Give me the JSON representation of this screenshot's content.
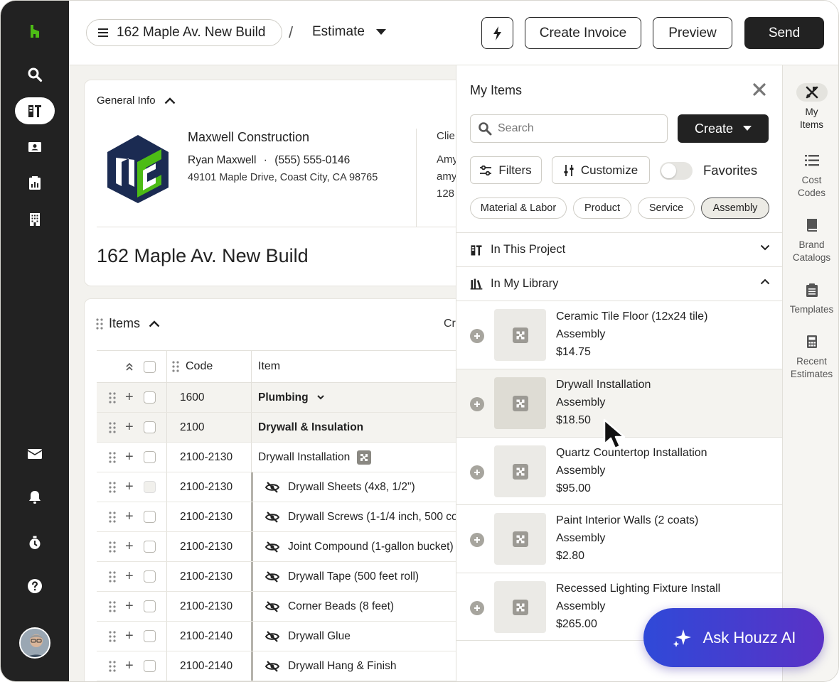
{
  "header": {
    "project_name": "162 Maple Av. New Build",
    "breadcrumb_sep": "/",
    "document_type": "Estimate",
    "create_invoice": "Create Invoice",
    "preview": "Preview",
    "send": "Send"
  },
  "general_info": {
    "title": "General Info",
    "company": "Maxwell Construction",
    "contact_name": "Ryan Maxwell",
    "contact_sep": "·",
    "phone": "(555) 555-0146",
    "address": "49101 Maple Drive, Coast City, CA 98765",
    "client_label_cut": "Clie",
    "client_line1_cut": "Amy",
    "client_line2_cut": "amy",
    "client_line3_cut": "128",
    "project_title": "162 Maple Av. New Build"
  },
  "items_section": {
    "title": "Items",
    "create_cut": "Cr",
    "columns": {
      "code": "Code",
      "item": "Item"
    },
    "rows": [
      {
        "code": "1600",
        "item": "Plumbing",
        "kind": "group-dropdown"
      },
      {
        "code": "2100",
        "item": "Drywall & Insulation",
        "kind": "group"
      },
      {
        "code": "2100-2130",
        "item": "Drywall Installation",
        "kind": "assembly"
      },
      {
        "code": "2100-2130",
        "item": "Drywall Sheets (4x8, 1/2\")",
        "kind": "hidden"
      },
      {
        "code": "2100-2130",
        "item": "Drywall Screws (1-1/4 inch, 500 co",
        "kind": "hidden"
      },
      {
        "code": "2100-2130",
        "item": "Joint Compound (1-gallon bucket)",
        "kind": "hidden"
      },
      {
        "code": "2100-2130",
        "item": "Drywall Tape (500 feet roll)",
        "kind": "hidden"
      },
      {
        "code": "2100-2130",
        "item": "Corner Beads (8 feet)",
        "kind": "hidden"
      },
      {
        "code": "2100-2140",
        "item": "Drywall Glue",
        "kind": "hidden"
      },
      {
        "code": "2100-2140",
        "item": "Drywall Hang & Finish",
        "kind": "hidden"
      }
    ]
  },
  "my_items": {
    "title": "My Items",
    "search_placeholder": "Search",
    "create": "Create",
    "filters": "Filters",
    "customize": "Customize",
    "favorites": "Favorites",
    "favorites_on": false,
    "chips": [
      "Material & Labor",
      "Product",
      "Service",
      "Assembly"
    ],
    "active_chip": "Assembly",
    "sections": {
      "in_project": "In This Project",
      "in_library": "In My Library"
    },
    "library": [
      {
        "name": "Ceramic Tile Floor (12x24 tile)",
        "type": "Assembly",
        "price": "$14.75"
      },
      {
        "name": "Drywall Installation",
        "type": "Assembly",
        "price": "$18.50"
      },
      {
        "name": "Quartz Countertop Installation",
        "type": "Assembly",
        "price": "$95.00"
      },
      {
        "name": "Paint Interior Walls (2 coats)",
        "type": "Assembly",
        "price": "$2.80"
      },
      {
        "name": "Recessed Lighting Fixture Install",
        "type": "Assembly",
        "price": "$265.00"
      }
    ]
  },
  "right_rail": [
    {
      "label_1": "My",
      "label_2": "Items",
      "icon": "my-items-icon"
    },
    {
      "label_1": "Cost",
      "label_2": "Codes",
      "icon": "list-icon"
    },
    {
      "label_1": "Brand",
      "label_2": "Catalogs",
      "icon": "book-icon"
    },
    {
      "label_1": "Templates",
      "label_2": "",
      "icon": "clipboard-icon"
    },
    {
      "label_1": "Recent",
      "label_2": "Estimates",
      "icon": "calculator-icon"
    }
  ],
  "ask_ai": "Ask Houzz AI",
  "colors": {
    "rail": "#222222",
    "brand_green": "#4dbc15",
    "logo_navy": "#1b2b52",
    "ai_gradient_start": "#2f49d8",
    "ai_gradient_end": "#5a32c6"
  }
}
